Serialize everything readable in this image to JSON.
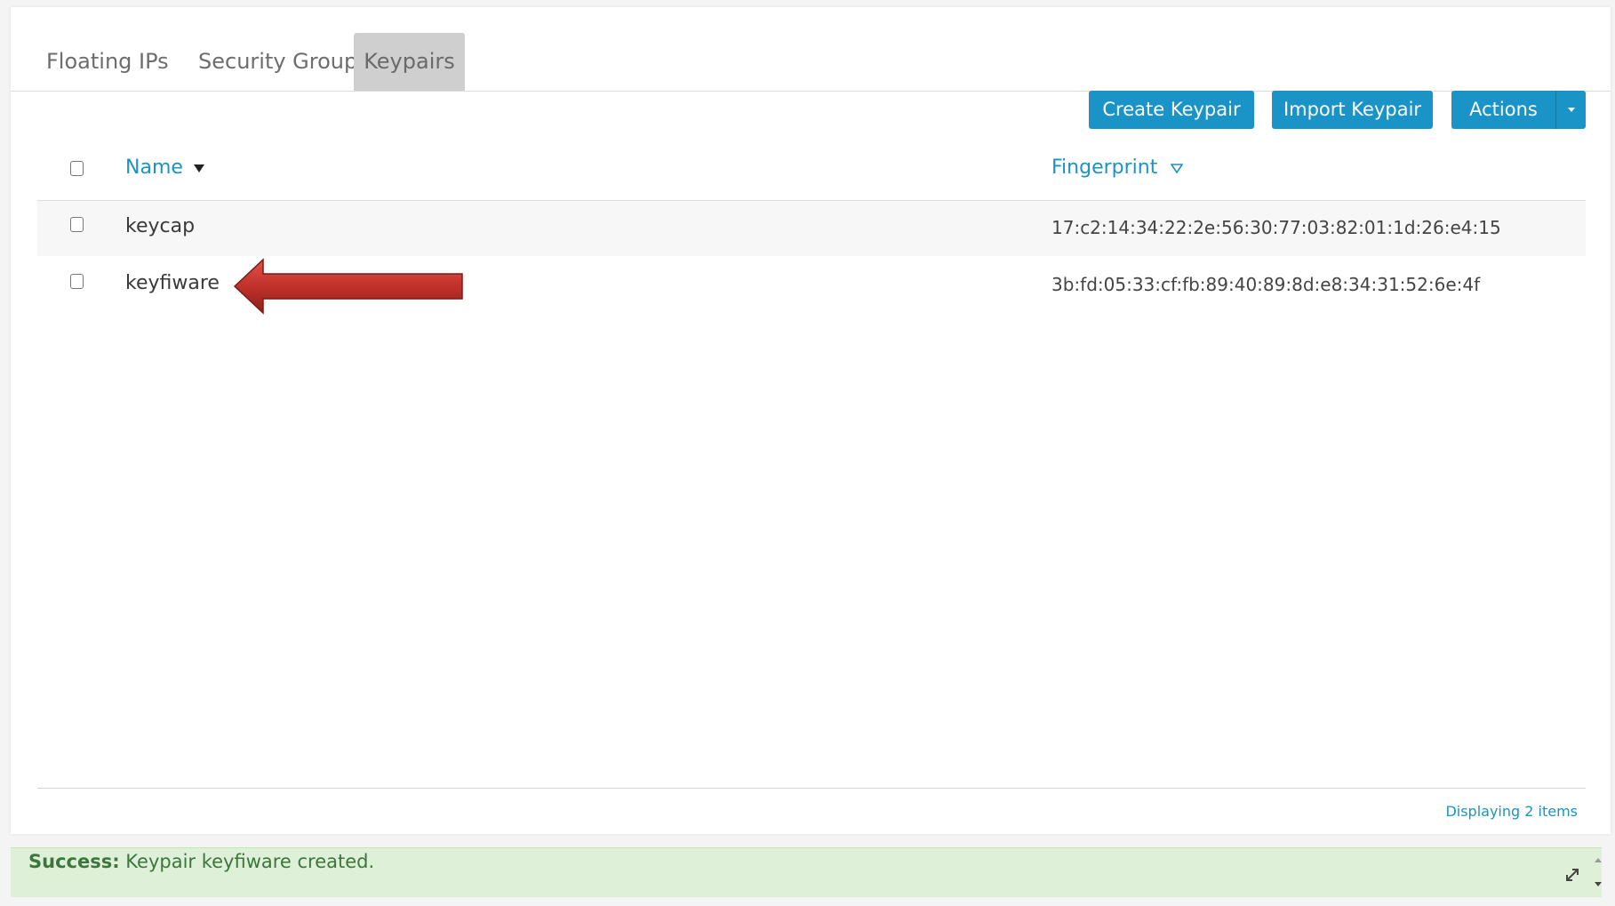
{
  "tabs": [
    {
      "label": "Floating IPs"
    },
    {
      "label": "Security Groups"
    },
    {
      "label": "Keypairs",
      "active": true
    }
  ],
  "toolbar": {
    "create_label": "Create Keypair",
    "import_label": "Import Keypair",
    "actions_label": "Actions"
  },
  "table": {
    "headers": {
      "name": "Name",
      "fingerprint": "Fingerprint"
    },
    "rows": [
      {
        "name": "keycap",
        "fingerprint": "17:c2:14:34:22:2e:56:30:77:03:82:01:1d:26:e4:15"
      },
      {
        "name": "keyfiware",
        "fingerprint": "3b:fd:05:33:cf:fb:89:40:89:8d:e8:34:31:52:6e:4f"
      }
    ],
    "count_text": "Displaying 2 items"
  },
  "alert": {
    "prefix": "Success:",
    "message": " Keypair keyfiware created."
  },
  "colors": {
    "primary": "#1a93c7",
    "active_tab": "#cfcfcf",
    "success_bg": "#dff0d8",
    "success_text": "#3c763d",
    "arrow": "#c0312b"
  },
  "icons": {
    "sort_name": "sort-descending-icon",
    "sort_fingerprint": "sort-unsorted-icon",
    "actions_caret": "caret-down-icon",
    "annotation": "red-arrow-icon",
    "tools": "resize-icon"
  }
}
